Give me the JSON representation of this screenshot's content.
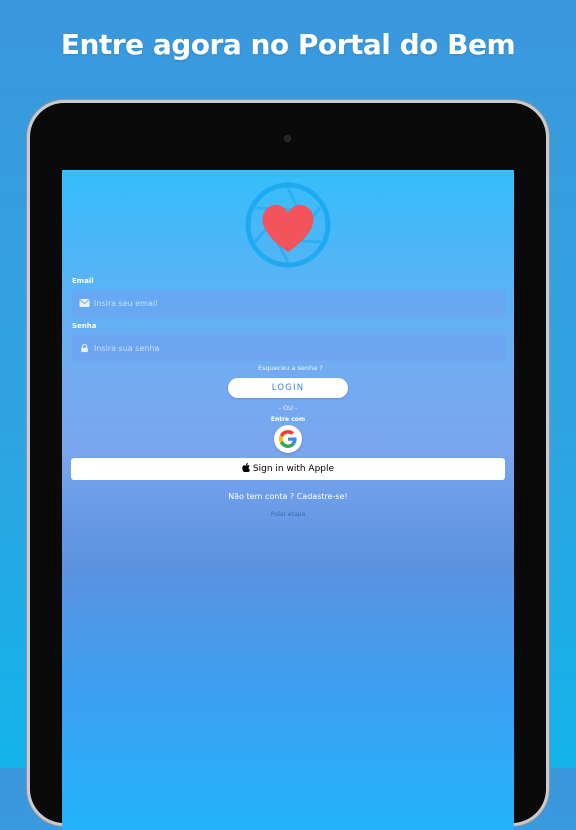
{
  "promo": {
    "headline": "Entre agora no Portal do Bem"
  },
  "app": {
    "logo_colors": {
      "ring": "#1aa8f0",
      "heart": "#f2545b"
    },
    "email": {
      "label": "Email",
      "placeholder": "Insira seu email",
      "value": "",
      "icon": "mail-icon"
    },
    "password": {
      "label": "Senha",
      "placeholder": "Insira sua senha",
      "value": "",
      "icon": "lock-icon"
    },
    "forgot_password": "Esqueceu a senha ?",
    "login_button": "LOGIN",
    "or_divider": "- OU -",
    "enter_with": "Entre com",
    "google_button": {
      "icon": "google-icon"
    },
    "apple_button": {
      "label": "Sign in with Apple",
      "icon": "apple-icon"
    },
    "signup_link": "Não tem conta ? Cadastre-se!",
    "skip_link": "Pular etapa"
  },
  "colors": {
    "accent": "#3b7fe0",
    "background_top": "#35bdfb",
    "background_bottom": "#22b3fb"
  }
}
